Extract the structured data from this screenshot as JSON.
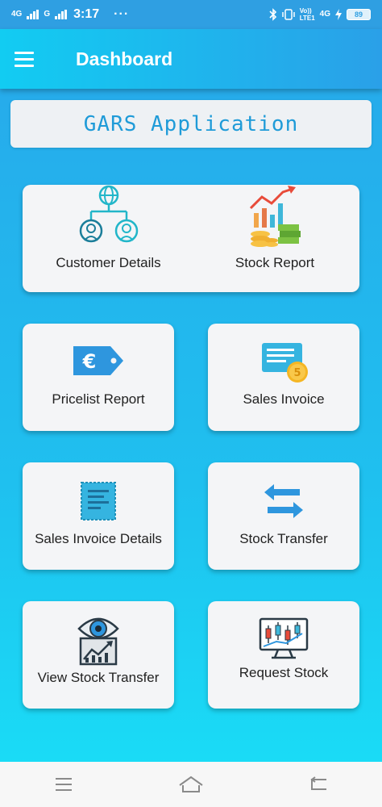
{
  "status_bar": {
    "network_1": "4G",
    "network_2": "G",
    "time": "3:17",
    "dots": "···",
    "lte": "LTE1",
    "volte": "Vo))",
    "network_3": "4G",
    "battery": "89"
  },
  "app_bar": {
    "title": "Dashboard"
  },
  "banner": {
    "title": "GARS Application"
  },
  "tiles": [
    {
      "label": "Customer Details",
      "icon": "customer-network-icon"
    },
    {
      "label": "Stock Report",
      "icon": "stock-chart-icon"
    },
    {
      "label": "Pricelist Report",
      "icon": "euro-tag-icon"
    },
    {
      "label": "Sales Invoice",
      "icon": "invoice-coin-icon"
    },
    {
      "label": "Sales Invoice Details",
      "icon": "invoice-document-icon"
    },
    {
      "label": "Stock Transfer",
      "icon": "transfer-arrows-icon"
    },
    {
      "label": "View Stock Transfer",
      "icon": "eye-chart-icon"
    },
    {
      "label": "Request Stock",
      "icon": "candlestick-monitor-icon"
    }
  ],
  "colors": {
    "accent": "#1f9bd8",
    "app_bar_start": "#12ccf2",
    "app_bar_end": "#2aa0e8",
    "card": "#f4f5f7"
  }
}
